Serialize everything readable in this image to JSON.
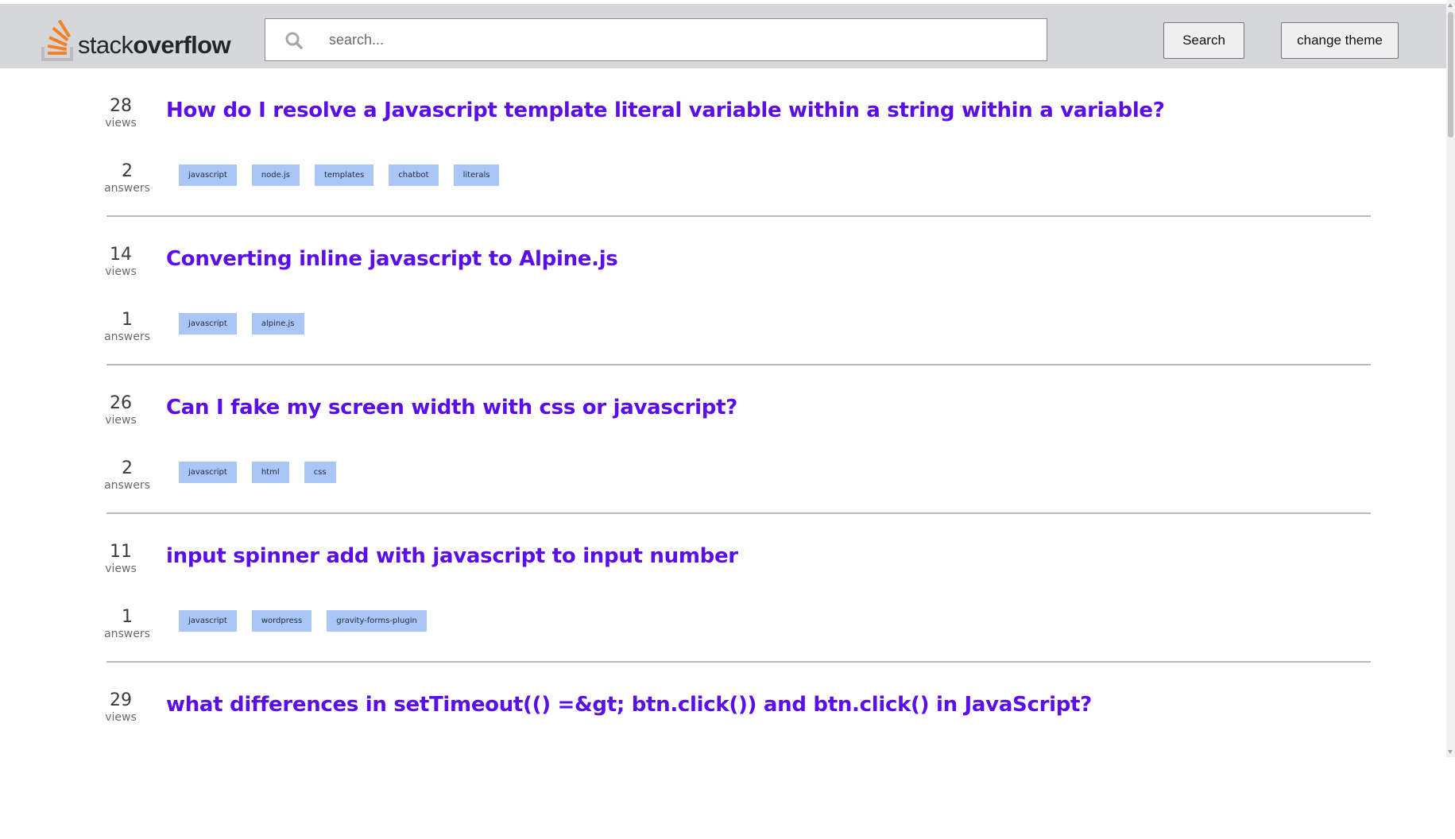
{
  "header": {
    "logo_text_light": "stack",
    "logo_text_bold": "overflow",
    "search_placeholder": "search...",
    "search_button": "Search",
    "theme_button": "change theme"
  },
  "colors": {
    "title": "#5a0ee8",
    "tag_bg": "#a9c6f7",
    "logo_orange": "#f48024",
    "logo_gray": "#bcbbbb",
    "header_bg": "#d5d7db"
  },
  "questions": [
    {
      "views": "28",
      "views_label": "views",
      "answers": "2",
      "answers_label": "answers",
      "title": "How do I resolve a Javascript template literal variable within a string within a variable?",
      "tags": [
        "javascript",
        "node.js",
        "templates",
        "chatbot",
        "literals"
      ]
    },
    {
      "views": "14",
      "views_label": "views",
      "answers": "1",
      "answers_label": "answers",
      "title": "Converting inline javascript to Alpine.js",
      "tags": [
        "javascript",
        "alpine.js"
      ]
    },
    {
      "views": "26",
      "views_label": "views",
      "answers": "2",
      "answers_label": "answers",
      "title": "Can I fake my screen width with css or javascript?",
      "tags": [
        "javascript",
        "html",
        "css"
      ]
    },
    {
      "views": "11",
      "views_label": "views",
      "answers": "1",
      "answers_label": "answers",
      "title": "input spinner add with javascript to input number",
      "tags": [
        "javascript",
        "wordpress",
        "gravity-forms-plugin"
      ]
    },
    {
      "views": "29",
      "views_label": "views",
      "answers": "",
      "answers_label": "",
      "title": "what differences in setTimeout(() =&gt; btn.click()) and btn.click() in JavaScript?",
      "tags": []
    }
  ]
}
